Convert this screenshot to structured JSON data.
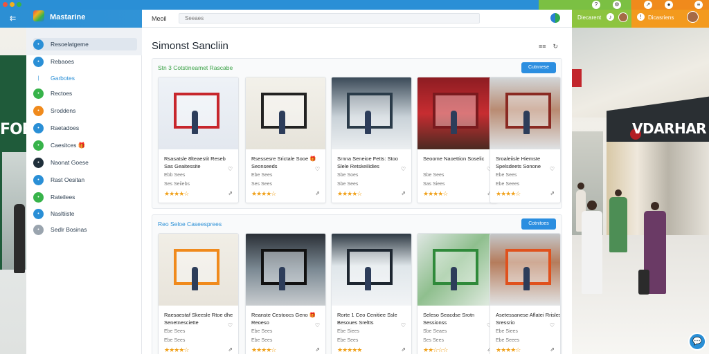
{
  "app": {
    "title": "Mastarine"
  },
  "top_right": {
    "label_a": "Diecarent",
    "label_b": "Dicasriens"
  },
  "search": {
    "label": "Meoil",
    "placeholder": "Seeaes"
  },
  "page": {
    "title": "Simonst Sancliin",
    "title_icon_a": "≡≡",
    "title_icon_b": "↻"
  },
  "sidebar": {
    "items": [
      {
        "label": "Resoelatgeme",
        "icon": "compass-icon",
        "color": "#2a8fd6"
      },
      {
        "label": "Rebaoes",
        "icon": "v-icon",
        "color": "#2a8fd6"
      },
      {
        "label": "Garbotes",
        "icon": "line-icon",
        "color": "#ffffff"
      },
      {
        "label": "Rectoes",
        "icon": "play-icon",
        "color": "#37b34a"
      },
      {
        "label": "Sroddens",
        "icon": "flame-icon",
        "color": "#f08a1c"
      },
      {
        "label": "Raetadoes",
        "icon": "grid-icon",
        "color": "#2a8fd6"
      },
      {
        "label": "Caesitces 🎁",
        "icon": "gift-icon",
        "color": "#37b34a"
      },
      {
        "label": "Naonat Goese",
        "icon": "shop-icon",
        "color": "#1f2f3a"
      },
      {
        "label": "Rast Oesitan",
        "icon": "people-icon",
        "color": "#2a8fd6"
      },
      {
        "label": "Rateilees",
        "icon": "chat-icon",
        "color": "#37b34a"
      },
      {
        "label": "Nasltiiste",
        "icon": "globe-icon",
        "color": "#2a8fd6"
      },
      {
        "label": "Sedlr Bosinas",
        "icon": "settings-icon",
        "color": "#9aa4ae"
      }
    ]
  },
  "sections": [
    {
      "title": "Stn 3 Cotstineamet Rascabe",
      "button": "Cutnnese",
      "cards": [
        {
          "name": "Rsasatsle 8lteaestit Reseb Sas Geaitessite",
          "meta": "Ebb  Sees",
          "meta2": "Ses Seiiebs",
          "stars": "★★★★☆"
        },
        {
          "name": "Rsessesre Srictale Sooe 🎁 Seonseeds",
          "meta": "Ebe Sees",
          "meta2": "Ses Sees",
          "stars": "★★★★☆"
        },
        {
          "name": "Srnna Seneioe Fetts: Stoo Slele Retskeilidies",
          "meta": "Sbe Soes",
          "meta2": "Sbe Sees",
          "stars": "★★★★☆"
        },
        {
          "name": "Seoome Naoettion Soselic",
          "meta": "Sbe Sees",
          "meta2": "Sas Siees",
          "stars": "★★★★☆"
        },
        {
          "name": "Sroaleiisle Hiemste Spelsdeets Sonone",
          "meta": "Ebe Sees",
          "meta2": "Ebe Seees",
          "stars": "★★★★☆"
        }
      ]
    },
    {
      "title": "Reo Seloe Caseesprees",
      "button": "Cotnitoes",
      "cards": [
        {
          "name": "Raesaestaf Skeesle Rtoe dhe Senetnesciette",
          "meta": "Ebe Sees",
          "meta2": "Ebe Sees",
          "stars": "★★★★☆"
        },
        {
          "name": "Reanste Cestoocs Geno 🎁 Reoeso",
          "meta": "Ebe Sees",
          "meta2": "Ebe Sees",
          "stars": "★★★★☆"
        },
        {
          "name": "Rorte 1 Ceo Cenitiee Ssle Besoues Sreltts",
          "meta": "Ebe Siees",
          "meta2": "Ebe Sees",
          "stars": "★★★★★"
        },
        {
          "name": "Seleso Seacdse Srotn Sessionss",
          "meta": "Sbe Seaes",
          "meta2": "Ses Sees",
          "stars": "★★☆☆☆"
        },
        {
          "name": "Asetessanese Aflatei Rrisles Sressrio",
          "meta": "Ebe Siees",
          "meta2": "Ebe Seees",
          "stars": "★★★★☆"
        }
      ]
    }
  ]
}
